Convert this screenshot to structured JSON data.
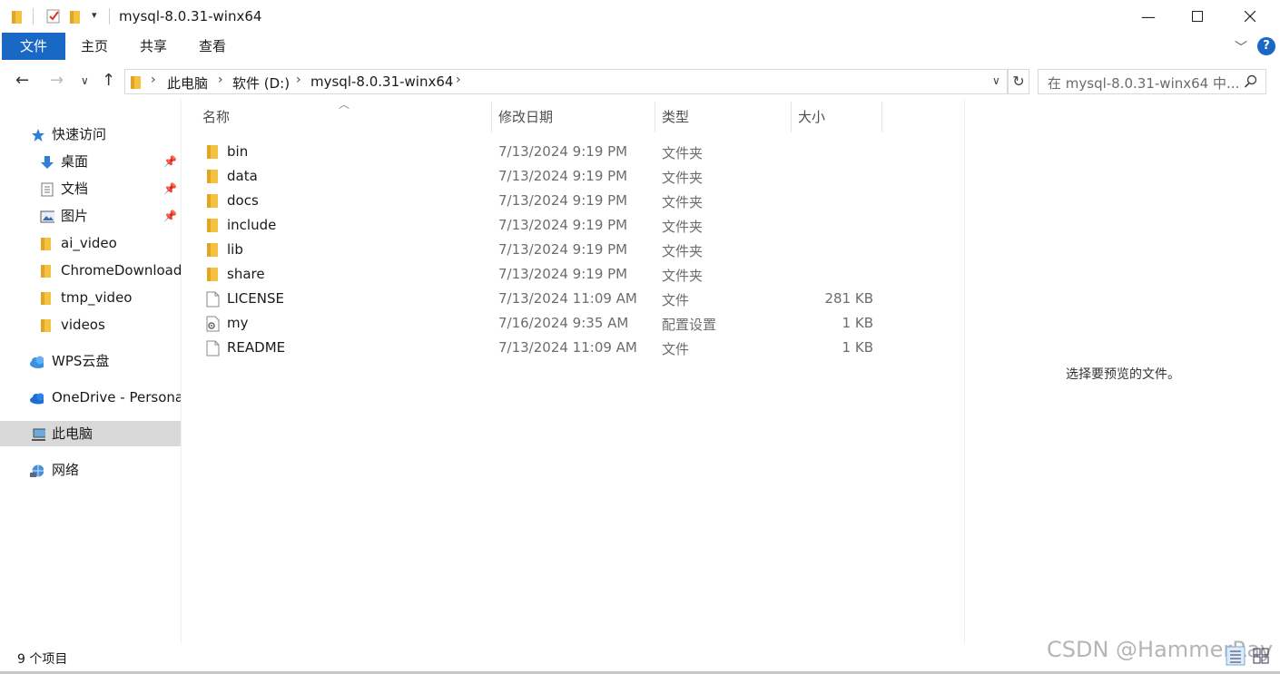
{
  "window": {
    "title": "mysql-8.0.31-winx64",
    "controls": [
      "minimize-icon",
      "maximize-icon",
      "close-icon"
    ]
  },
  "ribbon": {
    "tabs": [
      "文件",
      "主页",
      "共享",
      "查看"
    ],
    "help_label": "?"
  },
  "navigation": {
    "breadcrumbs": [
      "此电脑",
      "软件 (D:)",
      "mysql-8.0.31-winx64"
    ],
    "search_placeholder": "在 mysql-8.0.31-winx64 中..."
  },
  "sidebar": {
    "items": [
      {
        "label": "快速访问",
        "icon": "star-icon"
      },
      {
        "label": "桌面",
        "icon": "desktop-download-icon",
        "pinned": true
      },
      {
        "label": "文档",
        "icon": "document-icon",
        "pinned": true
      },
      {
        "label": "图片",
        "icon": "picture-icon",
        "pinned": true
      },
      {
        "label": "ai_video",
        "icon": "folder-icon"
      },
      {
        "label": "ChromeDownloads",
        "icon": "folder-icon"
      },
      {
        "label": "tmp_video",
        "icon": "folder-icon"
      },
      {
        "label": "videos",
        "icon": "folder-icon"
      },
      {
        "label": "WPS云盘",
        "icon": "cloud-icon"
      },
      {
        "label": "OneDrive - Personal",
        "icon": "onedrive-icon"
      },
      {
        "label": "此电脑",
        "icon": "computer-icon",
        "selected": true
      },
      {
        "label": "网络",
        "icon": "network-icon"
      }
    ]
  },
  "file_list": {
    "columns": [
      "名称",
      "修改日期",
      "类型",
      "大小"
    ],
    "rows": [
      {
        "name": "bin",
        "date": "7/13/2024 9:19 PM",
        "type": "文件夹",
        "size": "",
        "icon": "folder-icon"
      },
      {
        "name": "data",
        "date": "7/13/2024 9:19 PM",
        "type": "文件夹",
        "size": "",
        "icon": "folder-icon"
      },
      {
        "name": "docs",
        "date": "7/13/2024 9:19 PM",
        "type": "文件夹",
        "size": "",
        "icon": "folder-icon"
      },
      {
        "name": "include",
        "date": "7/13/2024 9:19 PM",
        "type": "文件夹",
        "size": "",
        "icon": "folder-icon"
      },
      {
        "name": "lib",
        "date": "7/13/2024 9:19 PM",
        "type": "文件夹",
        "size": "",
        "icon": "folder-icon"
      },
      {
        "name": "share",
        "date": "7/13/2024 9:19 PM",
        "type": "文件夹",
        "size": "",
        "icon": "folder-icon"
      },
      {
        "name": "LICENSE",
        "date": "7/13/2024 11:09 AM",
        "type": "文件",
        "size": "281 KB",
        "icon": "file-icon"
      },
      {
        "name": "my",
        "date": "7/16/2024 9:35 AM",
        "type": "配置设置",
        "size": "1 KB",
        "icon": "config-file-icon"
      },
      {
        "name": "README",
        "date": "7/13/2024 11:09 AM",
        "type": "文件",
        "size": "1 KB",
        "icon": "file-icon"
      }
    ]
  },
  "preview": {
    "message": "选择要预览的文件。"
  },
  "status": {
    "count": "9 个项目"
  },
  "watermark": "CSDN @HammerRay",
  "colors": {
    "accent": "#1968c6",
    "folder": "#f5c140",
    "selected": "#d9d9d9"
  }
}
